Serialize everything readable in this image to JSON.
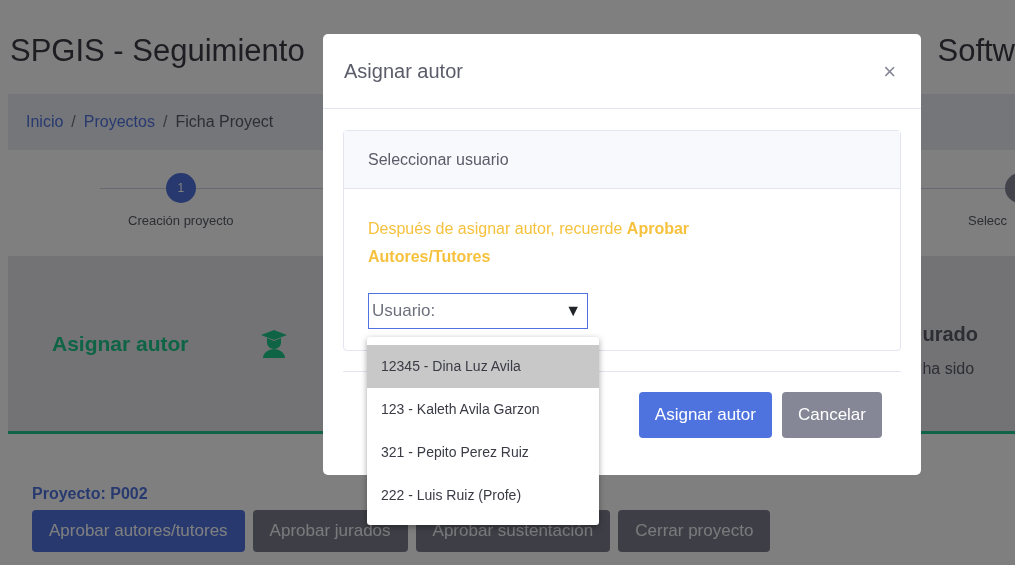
{
  "header": {
    "title_left": "SPGIS - Seguimiento",
    "title_right": "Softw"
  },
  "breadcrumb": [
    {
      "label": "Inicio",
      "kind": "link"
    },
    {
      "label": "/",
      "kind": "separator"
    },
    {
      "label": "Proyectos",
      "kind": "link"
    },
    {
      "label": "/",
      "kind": "separator"
    },
    {
      "label": "Ficha Proyect",
      "kind": "current"
    }
  ],
  "stepper": {
    "step_number": "1",
    "step_label": "Creación proyecto",
    "right_label": "Selecc"
  },
  "stage_card": {
    "title": "Asignar autor",
    "right_title": "urado",
    "right_text": "ha sido"
  },
  "project": {
    "label": "Proyecto: P002",
    "buttons": [
      {
        "label": "Aprobar autores/tutores",
        "disabled": false
      },
      {
        "label": "Aprobar jurados",
        "disabled": true
      },
      {
        "label": "Aprobar sustentación",
        "disabled": true
      },
      {
        "label": "Cerrar proyecto",
        "disabled": true
      }
    ]
  },
  "modal": {
    "title": "Asignar autor",
    "close": "×",
    "card_header": "Seleccionar usuario",
    "notice": "Después de asignar autor, recuerde **Aprobar Autores/Tutores**",
    "select": {
      "placeholder": "Usuario:",
      "arrow": "▼",
      "options": [
        {
          "label": "12345 - Dina Luz Avila",
          "selected": true
        },
        {
          "label": "123 - Kaleth Avila Garzon",
          "selected": false
        },
        {
          "label": "321 - Pepito Perez Ruiz",
          "selected": false
        },
        {
          "label": "222 - Luis Ruiz (Profe)",
          "selected": false
        }
      ]
    },
    "buttons": [
      {
        "label": "Asignar autor",
        "kind": "primary"
      },
      {
        "label": "Cancelar",
        "kind": "secondary"
      }
    ]
  }
}
